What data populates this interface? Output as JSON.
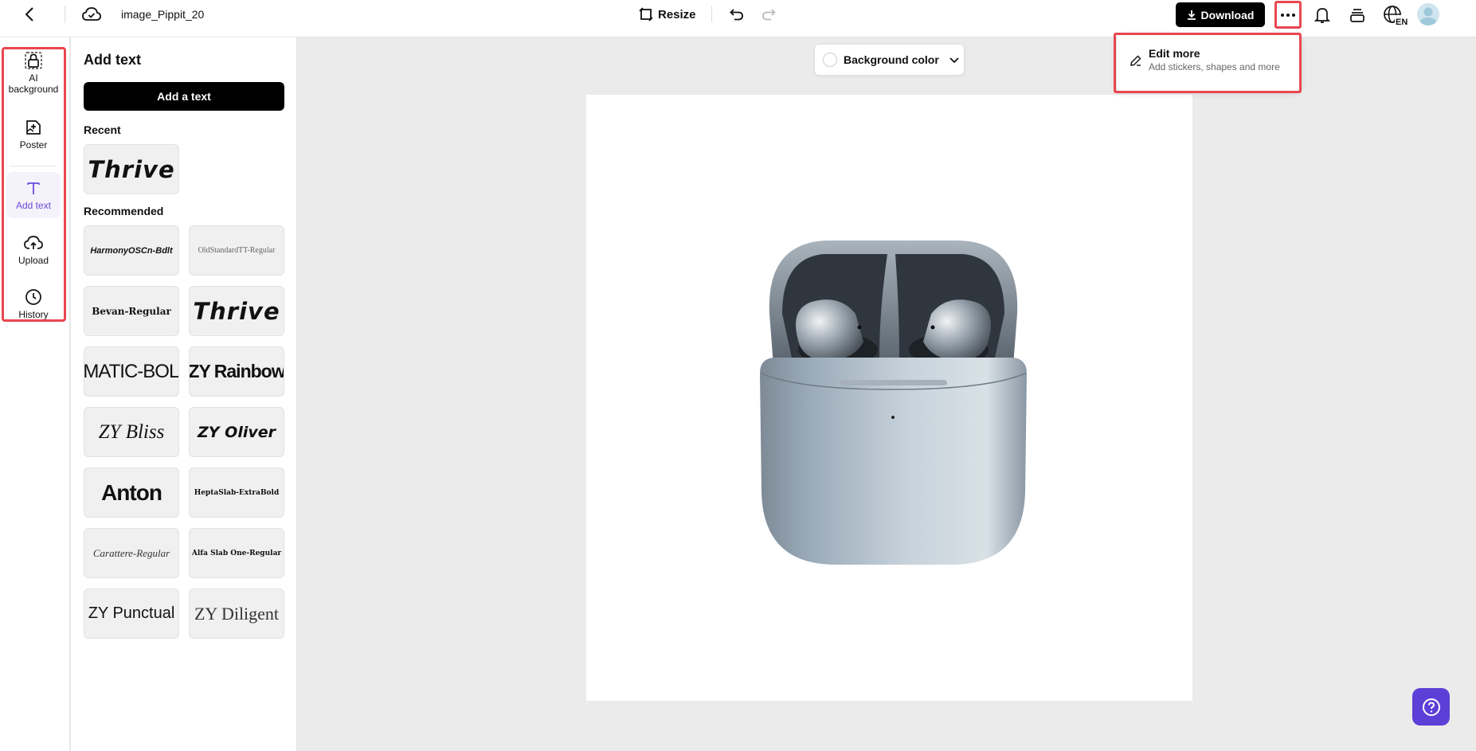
{
  "topbar": {
    "filename": "image_Pippit_20",
    "resize_label": "Resize",
    "download_label": "Download",
    "icons": [
      "back-icon",
      "cloud-icon",
      "resize-icon",
      "undo-icon",
      "redo-icon",
      "download-icon",
      "more-icon",
      "bell-icon",
      "layers-icon",
      "globe-icon",
      "avatar"
    ],
    "language_badge": "EN"
  },
  "rail": {
    "items": [
      {
        "label": "AI background",
        "icon": "lock-icon"
      },
      {
        "label": "Poster",
        "icon": "poster-icon"
      },
      {
        "label": "Add text",
        "icon": "text-icon",
        "active": true
      },
      {
        "label": "Upload",
        "icon": "upload-cloud-icon"
      },
      {
        "label": "History",
        "icon": "clock-icon"
      }
    ]
  },
  "panel": {
    "title": "Add text",
    "add_button": "Add a text",
    "recent_label": "Recent",
    "recommended_label": "Recommended",
    "recent": [
      "Thrive"
    ],
    "recommended": [
      "HarmonyOSCn-Bdlt",
      "OldStandardTT-Regular",
      "Bevan-Regular",
      "Thrive",
      "AMATIC-BOLD",
      "ZY Rainbow",
      "ZY Bliss",
      "ZY Oliver",
      "Anton",
      "HeptaSlab-ExtraBold",
      "Carattere-Regular",
      "Alfa Slab One-Regular",
      "ZY Punctual",
      "ZY Diligent"
    ]
  },
  "canvas": {
    "background_color_label": "Background color",
    "product": "earbuds-case-image"
  },
  "dropdown": {
    "title": "Edit more",
    "subtitle": "Add stickers, shapes and more"
  },
  "colors": {
    "accent": "#6a4bd9",
    "highlight": "#e8474f",
    "help": "#5b3fd6"
  }
}
